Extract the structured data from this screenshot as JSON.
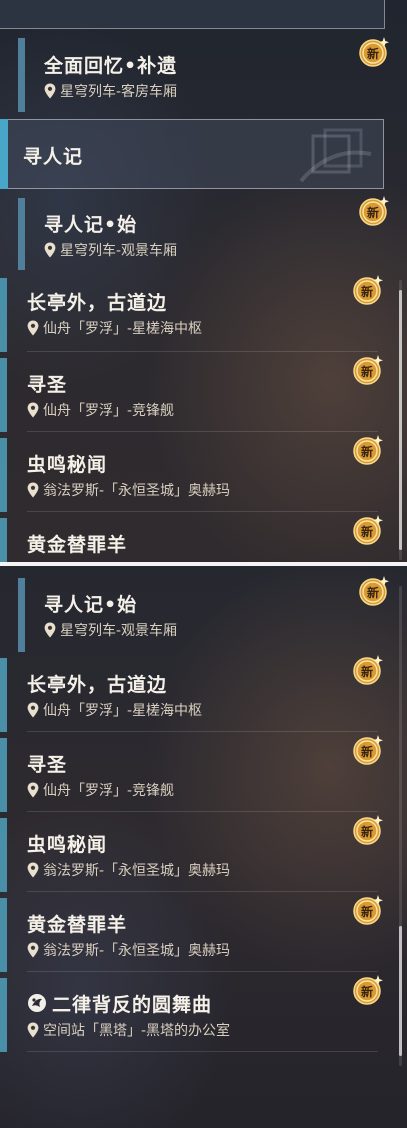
{
  "badge_label": "新",
  "top_panel": {
    "item_0": {
      "title": "全面回忆•补遗",
      "location": "星穹列车-客房车厢"
    },
    "category": {
      "title": "寻人记"
    },
    "item_1": {
      "title": "寻人记•始",
      "location": "星穹列车-观景车厢"
    },
    "item_2": {
      "title": "长亭外，古道边",
      "location": "仙舟「罗浮」-星槎海中枢"
    },
    "item_3": {
      "title": "寻圣",
      "location": "仙舟「罗浮」-竞锋舰"
    },
    "item_4": {
      "title": "虫鸣秘闻",
      "location": "翁法罗斯-「永恒圣城」奥赫玛"
    },
    "item_5": {
      "title": "黄金替罪羊"
    }
  },
  "bottom_panel": {
    "item_1": {
      "title": "寻人记•始",
      "location": "星穹列车-观景车厢"
    },
    "item_2": {
      "title": "长亭外，古道边",
      "location": "仙舟「罗浮」-星槎海中枢"
    },
    "item_3": {
      "title": "寻圣",
      "location": "仙舟「罗浮」-竞锋舰"
    },
    "item_4": {
      "title": "虫鸣秘闻",
      "location": "翁法罗斯-「永恒圣城」奥赫玛"
    },
    "item_5": {
      "title": "黄金替罪羊",
      "location": "翁法罗斯-「永恒圣城」奥赫玛"
    },
    "item_6": {
      "title": "二律背反的圆舞曲",
      "location": "空间站「黑塔」-黑塔的办公室"
    }
  },
  "colors": {
    "accent_bar": "#4a8fa8",
    "header_bar": "#48a6c8",
    "badge_gold": "#e0a23a"
  },
  "icons": [
    "location-pin-icon",
    "new-badge-icon",
    "quest-type-icon"
  ]
}
